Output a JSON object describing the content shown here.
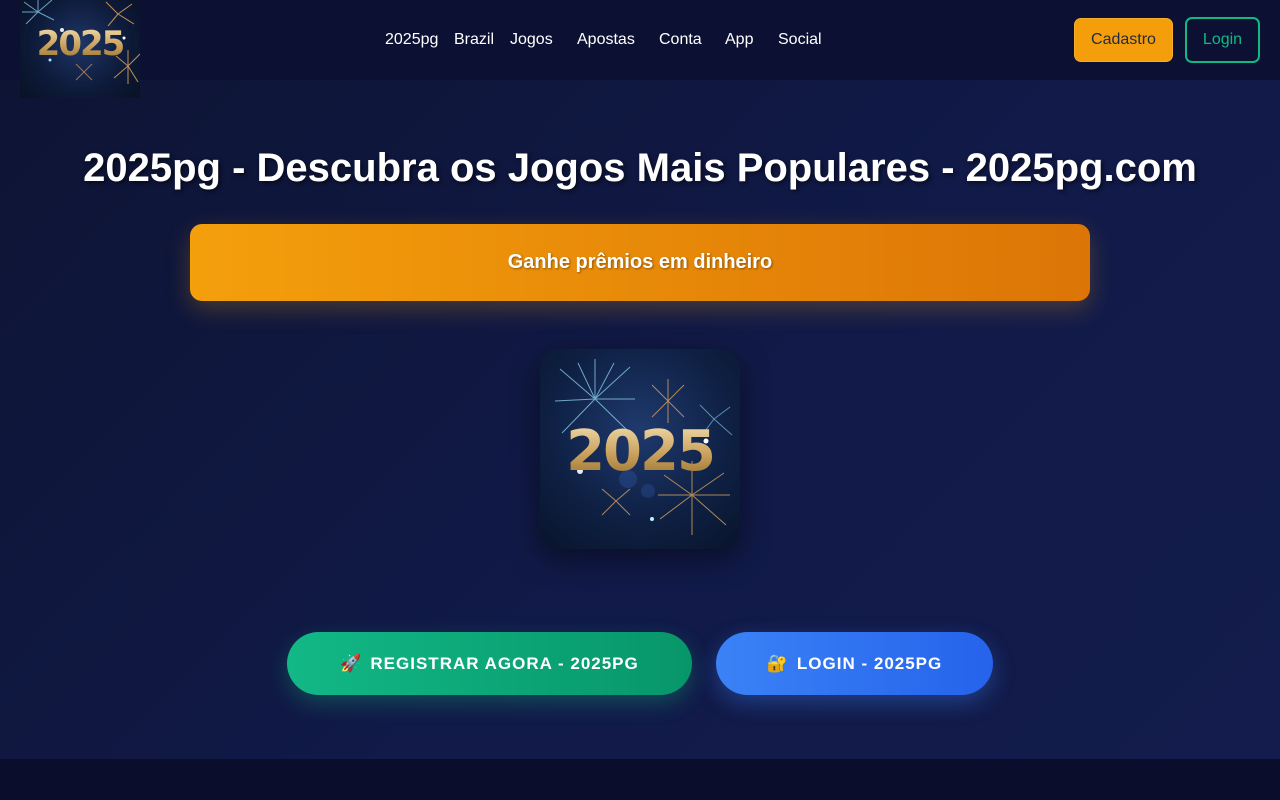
{
  "header": {
    "logo_text": "2025",
    "nav": [
      "2025pg",
      "Brazil",
      "Jogos",
      "Apostas",
      "Conta",
      "App",
      "Social"
    ],
    "cadastro_label": "Cadastro",
    "login_label": "Login"
  },
  "hero": {
    "title": "2025pg - Descubra os Jogos Mais Populares - 2025pg.com",
    "banner_text": "Ganhe prêmios em dinheiro",
    "image_text": "2025",
    "register_icon": "🚀",
    "register_label": "REGISTRAR AGORA - 2025PG",
    "login_icon": "🔐",
    "login_label": "LOGIN - 2025PG"
  },
  "colors": {
    "background": "#0d1434",
    "accent_orange": "#f59e0b",
    "accent_green": "#10b981",
    "accent_blue": "#3b82f6"
  }
}
